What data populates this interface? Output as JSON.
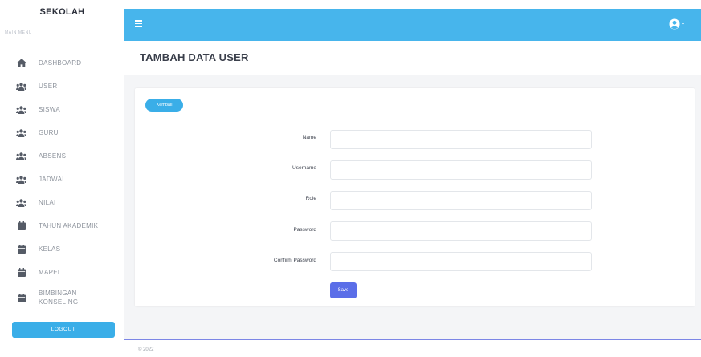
{
  "brand": "SEKOLAH",
  "menu_header": "MAIN MENU",
  "nav": [
    {
      "label": "DASHBOARD",
      "icon": "home-icon"
    },
    {
      "label": "USER",
      "icon": "users-icon"
    },
    {
      "label": "SISWA",
      "icon": "users-icon"
    },
    {
      "label": "GURU",
      "icon": "users-icon"
    },
    {
      "label": "ABSENSI",
      "icon": "users-icon"
    },
    {
      "label": "JADWAL",
      "icon": "users-icon"
    },
    {
      "label": "NILAI",
      "icon": "users-icon"
    },
    {
      "label": "TAHUN AKADEMIK",
      "icon": "calendar-icon"
    },
    {
      "label": "KELAS",
      "icon": "calendar-icon"
    },
    {
      "label": "MAPEL",
      "icon": "calendar-icon"
    },
    {
      "label": "BIMBINGAN KONSELING",
      "icon": "calendar-icon"
    }
  ],
  "logout_label": "LOGOUT",
  "page_title": "TAMBAH DATA USER",
  "back_label": "Kembali",
  "form": {
    "name_label": "Name",
    "username_label": "Username",
    "role_label": "Role",
    "password_label": "Password",
    "confirm_label": "Confirm Password",
    "name_value": "",
    "username_value": "",
    "role_value": "",
    "password_value": "",
    "confirm_value": ""
  },
  "save_label": "Save",
  "footer": "© 2022",
  "colors": {
    "topbar": "#47b5ec",
    "accent": "#3aaee8",
    "save_button": "#5b6ee8",
    "icon": "#555b66"
  }
}
